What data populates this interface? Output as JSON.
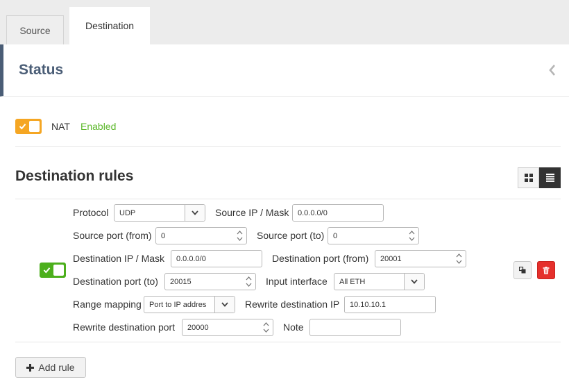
{
  "tabs": [
    {
      "label": "Source"
    },
    {
      "label": "Destination"
    }
  ],
  "status": {
    "title": "Status",
    "nat_label": "NAT",
    "nat_state": "Enabled",
    "nat_enabled": true
  },
  "destination": {
    "title": "Destination rules",
    "view_options": [
      "grid-view-icon",
      "list-view-icon"
    ],
    "active_view": "list"
  },
  "rule": {
    "enabled": true,
    "protocol_label": "Protocol",
    "protocol_value": "UDP",
    "source_ip_label": "Source IP / Mask",
    "source_ip_value": "0.0.0.0/0",
    "source_port_from_label": "Source port (from)",
    "source_port_from_value": "0",
    "source_port_to_label": "Source port (to)",
    "source_port_to_value": "0",
    "dest_ip_label": "Destination IP / Mask",
    "dest_ip_value": "0.0.0.0/0",
    "dest_port_from_label": "Destination port (from)",
    "dest_port_from_value": "20001",
    "dest_port_to_label": "Destination port (to)",
    "dest_port_to_value": "20015",
    "input_interface_label": "Input interface",
    "input_interface_value": "All ETH",
    "range_mapping_label": "Range mapping",
    "range_mapping_value": "Port to IP addres",
    "rewrite_ip_label": "Rewrite destination IP",
    "rewrite_ip_value": "10.10.10.1",
    "rewrite_port_label": "Rewrite destination port",
    "rewrite_port_value": "20000",
    "note_label": "Note",
    "note_value": ""
  },
  "add_rule_label": "Add rule",
  "colors": {
    "accent_dark": "#4a5d76",
    "toggle_orange": "#f5a623",
    "toggle_green": "#4caf1c",
    "enabled_text": "#5cb82b",
    "delete_red": "#e5302c"
  }
}
